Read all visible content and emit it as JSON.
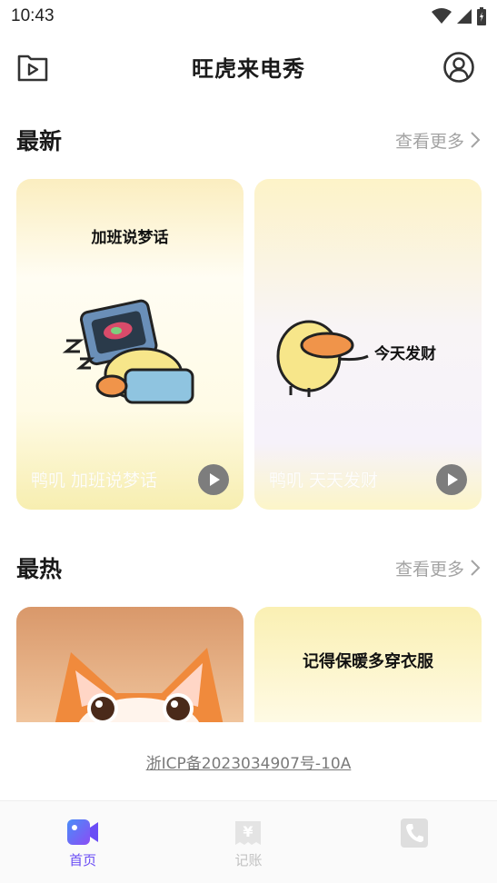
{
  "status": {
    "time": "10:43"
  },
  "header": {
    "title": "旺虎来电秀"
  },
  "sections": {
    "latest": {
      "title": "最新",
      "more_label": "查看更多"
    },
    "hot": {
      "title": "最热",
      "more_label": "查看更多"
    }
  },
  "latest_cards": [
    {
      "art_text": "加班说梦话",
      "caption": "鸭叽 加班说梦话"
    },
    {
      "art_text": "今天发财",
      "caption": "鸭叽 天天发财"
    }
  ],
  "hot_cards": [
    {
      "art_text": ""
    },
    {
      "art_text": "记得保暖多穿衣服"
    }
  ],
  "footer": {
    "icp": "浙ICP备2023034907号-10A"
  },
  "tabs": [
    {
      "label": "首页",
      "icon": "video-icon",
      "active": true
    },
    {
      "label": "记账",
      "icon": "yen-icon",
      "active": false
    },
    {
      "label": "",
      "icon": "phone-icon",
      "active": false
    }
  ],
  "colors": {
    "accent": "#6a4df5",
    "card_yellow": "#fbf1b8",
    "text_muted": "#a3a3a3"
  }
}
